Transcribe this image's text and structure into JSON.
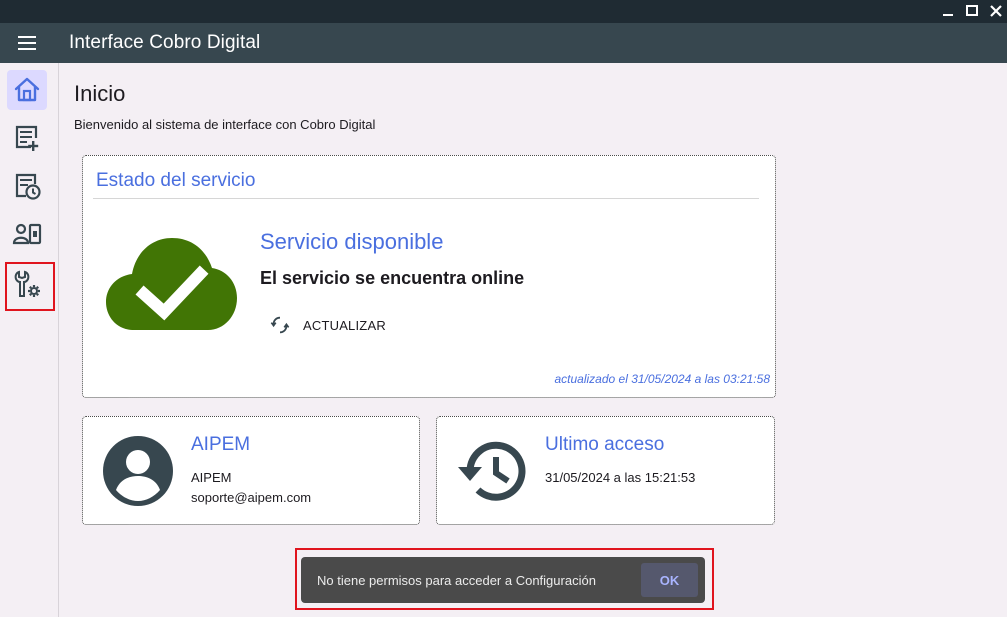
{
  "window": {
    "controls": {
      "minimize": "minimize-icon",
      "maximize": "maximize-icon",
      "close": "close-icon"
    }
  },
  "appbar": {
    "title": "Interface Cobro Digital",
    "menu_icon": "menu-icon"
  },
  "sidebar": {
    "items": [
      {
        "id": "inicio",
        "icon": "home-icon",
        "active": true
      },
      {
        "id": "nuevo",
        "icon": "note-add-icon",
        "active": false
      },
      {
        "id": "historial",
        "icon": "document-clock-icon",
        "active": false
      },
      {
        "id": "usuarios",
        "icon": "user-card-icon",
        "active": false
      },
      {
        "id": "configuracion",
        "icon": "tools-gear-icon",
        "active": false,
        "highlighted": true
      }
    ]
  },
  "page": {
    "title": "Inicio",
    "subtitle": "Bienvenido al sistema de interface con Cobro Digital"
  },
  "status_card": {
    "title": "Estado del servicio",
    "service_title": "Servicio disponible",
    "service_text": "El servicio se encuentra online",
    "refresh_label": "ACTUALIZAR",
    "updated_text": "actualizado el 31/05/2024 a las 03:21:58",
    "status_color": "#417505"
  },
  "user_card": {
    "title": "AIPEM",
    "name": "AIPEM",
    "email": "soporte@aipem.com"
  },
  "access_card": {
    "title": "Ultimo acceso",
    "date": "31/05/2024 a las 15:21:53"
  },
  "snackbar": {
    "message": "No tiene permisos para acceder a Configuración",
    "action_label": "OK"
  },
  "colors": {
    "accent": "#4a6fdf",
    "appbar": "#37474f",
    "titlebar": "#1f2b33",
    "highlight": "#e0141e",
    "icon_dark": "#37474f"
  }
}
